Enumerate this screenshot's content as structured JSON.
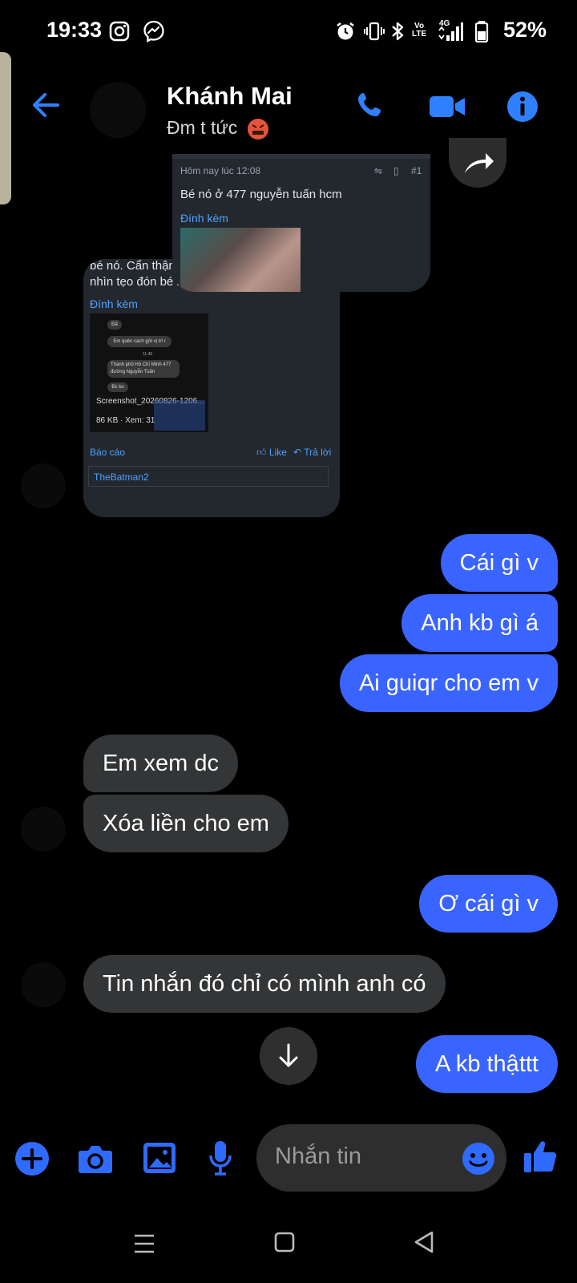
{
  "status_bar": {
    "time": "19:33",
    "volte": "Vo\nLTE",
    "network": "4G",
    "battery": "52%"
  },
  "header": {
    "contact_name": "Khánh Mai",
    "contact_status": "Đm t tức",
    "accent": "#2f80ff"
  },
  "shared_image_1": {
    "timestamp": "Hôm nay lúc 12:08",
    "post_number": "#1",
    "text": "Bé nó ở 477 nguyễn tuấn hcm",
    "attachment_label": "Đính kèm"
  },
  "shared_image_2": {
    "text_line1": "bé nó. Cẩn thận",
    "text_line2": "nhìn tẹo đón bé nó",
    "attachment_label": "Đính kèm",
    "chat_preview": {
      "msg1": "Đã",
      "msg2": "Em quên cách gửi vị trí r",
      "time": "11:46",
      "msg3_line1": "Thành phố Hồ Chí Minh 477",
      "msg3_line2": "đường Nguyễn Tuấn",
      "msg4": "Đc ko"
    },
    "file_name": "Screenshot_20260826-1206...",
    "file_meta": "86 KB · Xem: 31",
    "report": "Báo cáo",
    "like": "Like",
    "reply": "Trả lời",
    "liker": "TheBatman2"
  },
  "messages": [
    {
      "side": "mine",
      "text": "Cái gì v"
    },
    {
      "side": "mine",
      "text": "Anh kb gì á"
    },
    {
      "side": "mine",
      "text": "Ai guiqr cho em v"
    },
    {
      "side": "theirs",
      "text": "Em xem dc"
    },
    {
      "side": "theirs",
      "text": "Xóa liền cho em"
    },
    {
      "side": "mine",
      "text": "Ơ cái gì v"
    },
    {
      "side": "theirs",
      "text": "Tin nhắn đó chỉ có mình anh có"
    },
    {
      "side": "mine",
      "text": "A kb thậttt"
    }
  ],
  "composer": {
    "placeholder": "Nhắn tin"
  },
  "colors": {
    "my_bubble": "#3a64ff",
    "their_bubble": "#333537",
    "icon_blue": "#2f6bff"
  }
}
